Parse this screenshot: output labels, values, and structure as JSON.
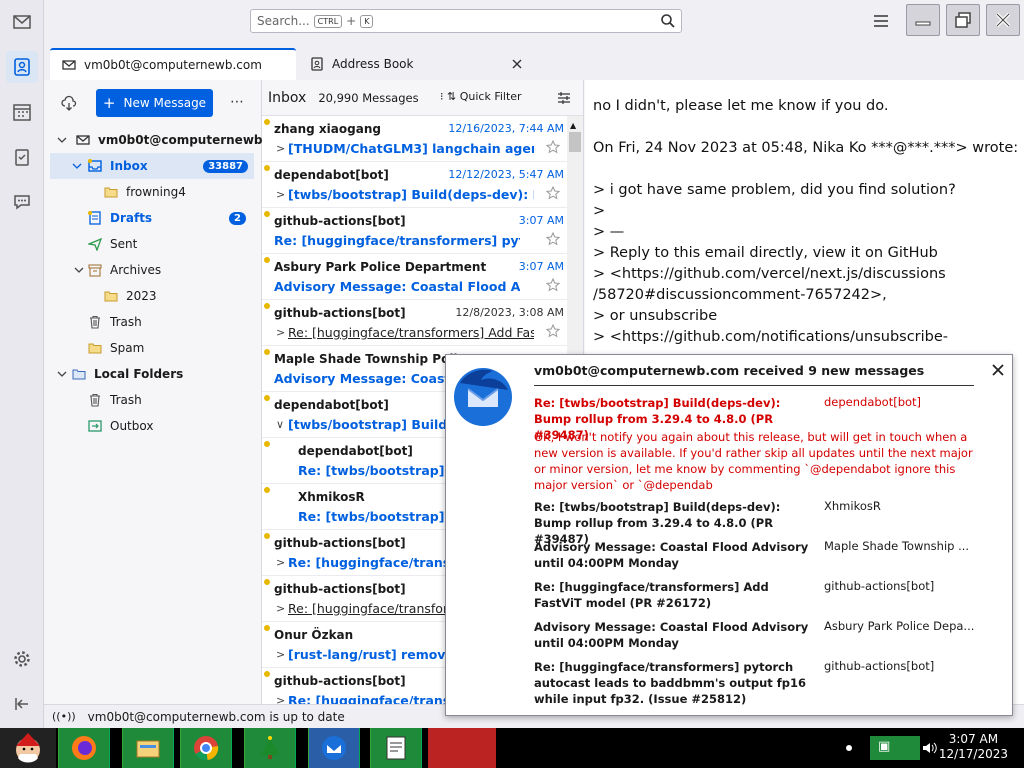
{
  "search": {
    "placeholder": "Search...",
    "key1": "CTRL",
    "plus": "+",
    "key2": "K"
  },
  "tabs": [
    {
      "label": "vm0b0t@computernewb.com"
    },
    {
      "label": "Address Book"
    }
  ],
  "folderpane": {
    "new_message": "New Message",
    "account": "vm0b0t@computernewb...",
    "folders": [
      {
        "label": "Inbox",
        "badge": "33887"
      },
      {
        "label": "frowning4"
      },
      {
        "label": "Drafts",
        "badge": "2"
      },
      {
        "label": "Sent"
      },
      {
        "label": "Archives"
      },
      {
        "label": "2023"
      },
      {
        "label": "Trash"
      },
      {
        "label": "Spam"
      },
      {
        "label": "Local Folders"
      },
      {
        "label": "Trash"
      },
      {
        "label": "Outbox"
      }
    ]
  },
  "threadpane": {
    "title": "Inbox",
    "count": "20,990 Messages",
    "quick_filter": "Quick Filter",
    "rows": [
      {
        "from": "zhang xiaogang",
        "date": "12/16/2023, 7:44 AM",
        "subject": "[THUDM/ChatGLM3] langchain agent..."
      },
      {
        "from": "dependabot[bot]",
        "date": "12/12/2023, 5:47 AM",
        "subject": "[twbs/bootstrap] Build(deps-dev): Bu..."
      },
      {
        "from": "github-actions[bot]",
        "date": "3:07 AM",
        "subject": "Re: [huggingface/transformers] pytorch..."
      },
      {
        "from": "Asbury Park Police Department",
        "date": "3:07 AM",
        "subject": "Advisory Message: Coastal Flood Advis..."
      },
      {
        "from": "github-actions[bot]",
        "date": "12/8/2023, 3:08 AM",
        "subject": "Re: [huggingface/transformers] Add Fas..."
      },
      {
        "from": "Maple Shade Township Police D",
        "date": "",
        "subject": "Advisory Message: Coastal"
      },
      {
        "from": "dependabot[bot]",
        "date": "",
        "subject": "[twbs/bootstrap] Build(de"
      },
      {
        "from": "dependabot[bot]",
        "date": "",
        "subject": "Re: [twbs/bootstrap] Bu"
      },
      {
        "from": "XhmikosR",
        "date": "",
        "subject": "Re: [twbs/bootstrap] Bu"
      },
      {
        "from": "github-actions[bot]",
        "date": "",
        "subject": "Re: [huggingface/transform"
      },
      {
        "from": "github-actions[bot]",
        "date": "",
        "subject": "Re: [huggingface/transform"
      },
      {
        "from": "Onur Özkan",
        "date": "",
        "subject": "[rust-lang/rust] remove `"
      },
      {
        "from": "github-actions[bot]",
        "date": "",
        "subject": "Re: [huggingface/transform"
      }
    ]
  },
  "message": {
    "lines": [
      "no I didn't, please let me know if you do.",
      "On Fri, 24 Nov 2023 at 05:48, Nika Ko ***@***.***> wrote:",
      "> i got have same problem, did you find solution?",
      ">",
      "> —",
      "> Reply to this email directly, view it on GitHub",
      "> <https://github.com/vercel/next.js/discussions",
      "/58720#discussioncomment-7657242>,",
      "> or unsubscribe",
      "> <https://github.com/notifications/unsubscribe-"
    ]
  },
  "status": {
    "text": "vm0b0t@computernewb.com is up to date"
  },
  "notification": {
    "title": "vm0b0t@computernewb.com received 9 new messages",
    "first": {
      "subject": "Re: [twbs/bootstrap] Build(deps-dev): Bump rollup from 3.29.4 to 4.8.0 (PR #39487)",
      "author": "dependabot[bot]",
      "body": "OK, I won't notify you again about this release, but will get in touch when a new version is available. If you'd rather skip all updates until the next major or minor version, let me know by commenting `@dependabot ignore this major version` or `@dependab"
    },
    "items": [
      {
        "subject": "Re: [twbs/bootstrap] Build(deps-dev): Bump rollup from 3.29.4 to 4.8.0 (PR #39487)",
        "author": "XhmikosR"
      },
      {
        "subject": "Advisory Message: Coastal Flood Advisory until 04:00PM Monday",
        "author": "Maple Shade Township ..."
      },
      {
        "subject": "Re: [huggingface/transformers] Add FastViT model (PR #26172)",
        "author": "github-actions[bot]"
      },
      {
        "subject": "Advisory Message: Coastal Flood Advisory until 04:00PM Monday",
        "author": "Asbury Park Police Depa..."
      },
      {
        "subject": "Re: [huggingface/transformers] pytorch autocast leads to baddbmm's output fp16 while input fp32. (Issue #25812)",
        "author": "github-actions[bot]"
      }
    ]
  },
  "clock": {
    "time": "3:07 AM",
    "date": "12/17/2023"
  },
  "colors": {
    "accent": "#0060df",
    "unread_blue": "#0060df",
    "notif_red": "#d40000"
  }
}
